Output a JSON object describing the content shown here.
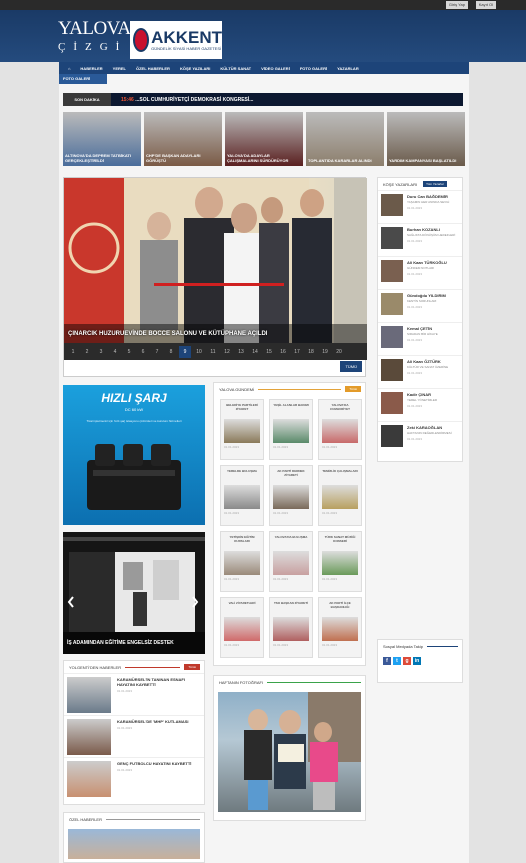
{
  "top": {
    "link1": "Giriş Yap",
    "link2": "Kayıt Ol"
  },
  "logo": {
    "yalova": "YALOVA",
    "cizgi": "ÇİZGİ",
    "akkent": "AKKENT",
    "akkent_sub": "GÜNDELİK SİYASİ HABER GAZETESİ"
  },
  "nav": [
    "⌂",
    "HABERLER",
    "YEREL",
    "ÖZEL HABERLER",
    "KÖŞE YAZILARI",
    "KÜLTÜR SANAT",
    "VİDEO GALERİ",
    "FOTO GALERİ",
    "YAZARLAR"
  ],
  "nav2": "FOTO GALERİ",
  "ticker": {
    "label": "SON DAKİKA",
    "hot": "15:46 ",
    "text": "...SOL CUMHURİYETÇİ DEMOKRASİ KONGRESİ..."
  },
  "headlines": [
    {
      "cap": "ALTINOVA'DA DEPREM TATBİKATI GERÇEKLEŞTİRİLDİ",
      "color": "#4a6d9b"
    },
    {
      "cap": "CHP'DE BAŞKAN ADAYLARI GÖRÜŞTÜ",
      "color": "#7a5a45"
    },
    {
      "cap": "YALOVA'DA ADAYLAR ÇALIŞMALARINI SÜRDÜRÜYOR",
      "color": "#5a2020"
    },
    {
      "cap": "TOPLANTIDA KARARLAR ALINDI",
      "color": "#8c7e6c"
    },
    {
      "cap": "YARDIM KAMPANYASI BAŞLATILDI",
      "color": "#6a5a4a"
    }
  ],
  "slider": {
    "caption": "ÇINARCIK HUZURUEVİNDE BOCCE SALONU VE KÜTÜPHANE AÇILDI",
    "pages": [
      "1",
      "2",
      "3",
      "4",
      "5",
      "6",
      "7",
      "8",
      "9",
      "10",
      "11",
      "12",
      "13",
      "14",
      "15",
      "16",
      "17",
      "18",
      "19",
      "20"
    ],
    "active": "9",
    "all_label": "TÜMÜ"
  },
  "columns": {
    "title": "KÖŞE YAZARLARI",
    "tab": "Tüm Yazarlar",
    "items": [
      {
        "name": "Duru Can BAĞDEMİR",
        "title": "YAŞAMIN HER ANINDA SEVGİ",
        "date": "01.01.2023",
        "color": "#6b5a4a"
      },
      {
        "name": "Burhan KOZANLI",
        "title": "SAĞLIKTA DÖNÜŞÜM HEDEFLERİ",
        "date": "01.01.2023",
        "color": "#4a4a4a"
      },
      {
        "name": "Ali Kaan TÜRKOĞLU",
        "title": "GÜNDEM NOTLARI",
        "date": "01.01.2023",
        "color": "#7a6050"
      },
      {
        "name": "Gündoğdu YILDIRIM",
        "title": "KENTİN SORUNLARI",
        "date": "01.01.2023",
        "color": "#9a8a6a"
      },
      {
        "name": "Kemal ÇETİN",
        "title": "SIRADAN BİR HİKAYE",
        "date": "01.01.2023",
        "color": "#6a6a7a"
      },
      {
        "name": "Ali Kaan ÖZTÜRK",
        "title": "KÜLTÜR VE SANAT ÜZERİNE",
        "date": "01.01.2023",
        "color": "#5a4a3a"
      },
      {
        "name": "Kadir ÇINAR",
        "title": "YEREL YÖNETİMLER",
        "date": "01.01.2023",
        "color": "#8a5a4a"
      },
      {
        "name": "Zeki KARAOĞLAN",
        "title": "HAFTANIN DEĞERLENDİRMESİ",
        "date": "01.01.2023",
        "color": "#3a3a3a"
      }
    ]
  },
  "ad": {
    "title": "HIZLI ŞARJ",
    "sub": "DC 60 kW",
    "desc": "Ticari işletmeniz için hızlı şarj istasyonu çözümleri ve kurulum hizmetleri"
  },
  "video": {
    "caption": "İŞ ADAMINDAN EĞİTİME ENGELSİZ DESTEK"
  },
  "gallery": {
    "title": "YALOVA GÜNDEMİ",
    "tag": "Tümü",
    "cards": [
      {
        "t": "BELEDİYE PARTİLERİ ZİYARET",
        "d": "01.01.2023",
        "c": "#8a7a5a"
      },
      {
        "t": "YEŞİL ALANLAR BAKIMI",
        "d": "01.01.2023",
        "c": "#5a8a6a"
      },
      {
        "t": "YALOVA'DA CUMHURİYET",
        "d": "01.01.2023",
        "c": "#c86a6a"
      },
      {
        "t": "YERELDE BULUŞMA",
        "d": "01.01.2023",
        "c": "#8a8a8a"
      },
      {
        "t": "AK PARTİ DERNEK ZİYARETİ",
        "d": "01.01.2023",
        "c": "#7a6a5a"
      },
      {
        "t": "TEMİZLİK ÇALIŞMALARI",
        "d": "01.01.2023",
        "c": "#b8a060"
      },
      {
        "t": "YETİŞKİN EĞİTİM KURSLARI",
        "d": "01.01.2023",
        "c": "#9a8a7a"
      },
      {
        "t": "YALOVA'DA BULUŞMA",
        "d": "01.01.2023",
        "c": "#c8a0a0"
      },
      {
        "t": "TÜRK SANAT MÜZİĞİ KONSERİ",
        "d": "01.01.2023",
        "c": "#6a9a5a"
      },
      {
        "t": "VALİ ZİYARETLERİ",
        "d": "01.01.2023",
        "c": "#d06a6a"
      },
      {
        "t": "TSO BAŞKAN ZİYARETİ",
        "d": "01.01.2023",
        "c": "#b06060"
      },
      {
        "t": "AK PARTİ İLÇE BAŞKANLIĞI",
        "d": "01.01.2023",
        "c": "#c07050"
      }
    ]
  },
  "news": {
    "title": "YOLGENTİ'DEN HABERLER",
    "tag": "Tümü",
    "items": [
      {
        "t": "KARAMÜRSEL'İN TANINAN ESNAFI HAYATINI KAYBETTİ",
        "d": "01.01.2023",
        "c": "#6a7a8a"
      },
      {
        "t": "KARAMÜRSEL'DE 'MHP' KUTLAMASI",
        "d": "01.01.2023",
        "c": "#7a5a4a"
      },
      {
        "t": "GENÇ FUTBOLCU HAYATINI KAYBETTİ",
        "d": "01.01.2023",
        "c": "#c89070"
      }
    ]
  },
  "photo": {
    "title": "HAFTANIN FOTOĞRAFI"
  },
  "ozel": {
    "title": "ÖZEL HABERLER"
  },
  "social": {
    "title": "Sosyal Medyada Takip",
    "icons": [
      {
        "n": "facebook-icon",
        "c": "#3b5998",
        "g": "f"
      },
      {
        "n": "twitter-icon",
        "c": "#1da1f2",
        "g": "t"
      },
      {
        "n": "google-plus-icon",
        "c": "#dd4b39",
        "g": "g"
      },
      {
        "n": "linkedin-icon",
        "c": "#0077b5",
        "g": "in"
      }
    ]
  }
}
